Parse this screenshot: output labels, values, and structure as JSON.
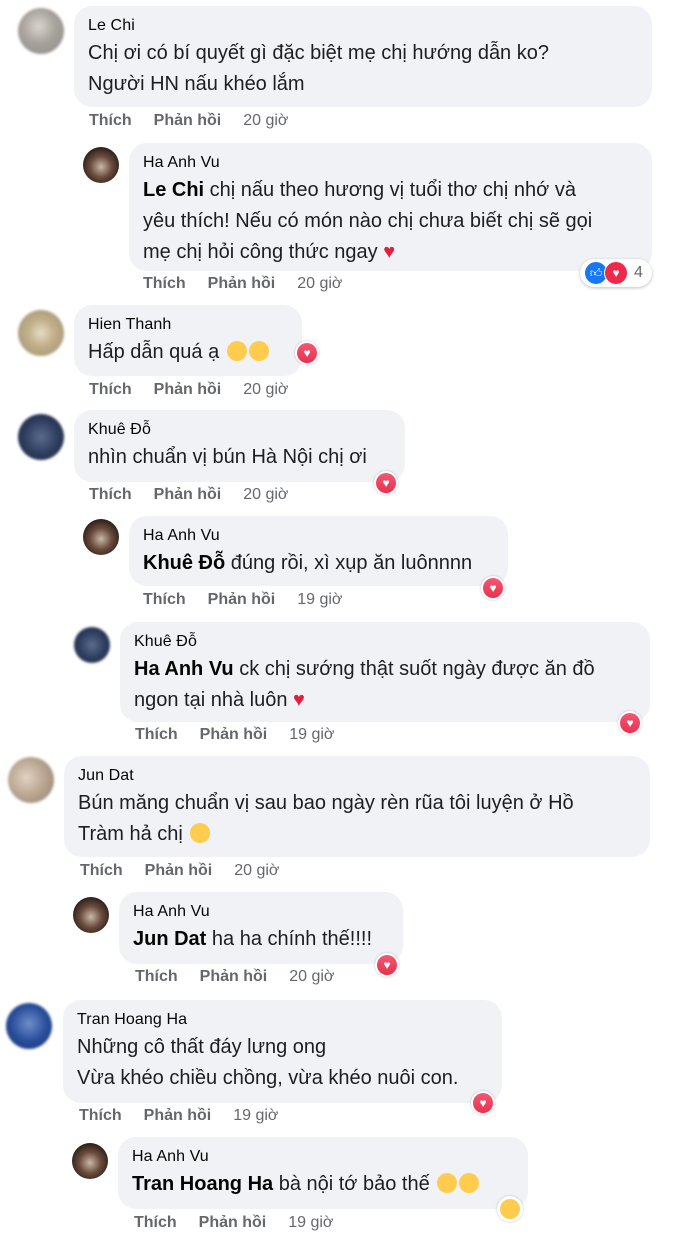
{
  "comments": [
    {
      "name": "Le Chi",
      "lines": [
        "Chị ơi có bí quyết gì đặc biệt mẹ chị hướng dẫn ko?",
        "Người HN nấu khéo lắm"
      ],
      "like": "Thích",
      "reply": "Phản hồi",
      "time": "20 giờ"
    },
    {
      "name": "Ha Anh Vu",
      "mention": "Le Chi",
      "lines": [
        " chị nấu theo hương vị tuổi thơ chị nhớ và",
        "yêu thích! Nếu có món nào chị chưa biết chị sẽ gọi",
        "mẹ chị hỏi công thức ngay"
      ],
      "like": "Thích",
      "reply": "Phản hồi",
      "time": "20 giờ",
      "reaction_count": "4"
    },
    {
      "name": "Hien Thanh",
      "lines": [
        "Hấp dẫn quá ạ"
      ],
      "like": "Thích",
      "reply": "Phản hồi",
      "time": "20 giờ"
    },
    {
      "name": "Khuê Đỗ",
      "lines": [
        "nhìn chuẩn vị bún Hà Nội chị ơi"
      ],
      "like": "Thích",
      "reply": "Phản hồi",
      "time": "20 giờ"
    },
    {
      "name": "Ha Anh Vu",
      "mention": "Khuê Đỗ",
      "lines": [
        " đúng rồi, xì xụp ăn luônnnn"
      ],
      "like": "Thích",
      "reply": "Phản hồi",
      "time": "19 giờ"
    },
    {
      "name": "Khuê Đỗ",
      "mention": "Ha Anh Vu",
      "lines": [
        " ck chị sướng thật suốt ngày được ăn đồ",
        "ngon tại nhà luôn"
      ],
      "like": "Thích",
      "reply": "Phản hồi",
      "time": "19 giờ"
    },
    {
      "name": "Jun Dat",
      "lines": [
        "Bún măng chuẩn vị sau bao ngày rèn rũa tôi luyện ở Hồ",
        "Tràm hả chị"
      ],
      "like": "Thích",
      "reply": "Phản hồi",
      "time": "20 giờ"
    },
    {
      "name": "Ha Anh Vu",
      "mention": "Jun Dat",
      "lines": [
        " ha ha chính thế!!!!"
      ],
      "like": "Thích",
      "reply": "Phản hồi",
      "time": "20 giờ"
    },
    {
      "name": "Tran Hoang Ha",
      "lines": [
        "Những cô thất đáy lưng ong",
        "Vừa khéo chiều chồng, vừa khéo nuôi con."
      ],
      "like": "Thích",
      "reply": "Phản hồi",
      "time": "19 giờ"
    },
    {
      "name": "Ha Anh Vu",
      "mention": "Tran Hoang Ha",
      "lines": [
        " bà nội tớ bảo thế"
      ],
      "like": "Thích",
      "reply": "Phản hồi",
      "time": "19 giờ"
    }
  ],
  "colors": {
    "bubble": "#f0f2f5",
    "meta": "#65676b",
    "heart": "#e8314f",
    "like": "#1877f2"
  },
  "icons": {
    "heart": "heart-icon",
    "like": "like-icon",
    "laugh": "laugh-emoji-icon",
    "love_eyes": "heart-eyes-emoji-icon"
  }
}
